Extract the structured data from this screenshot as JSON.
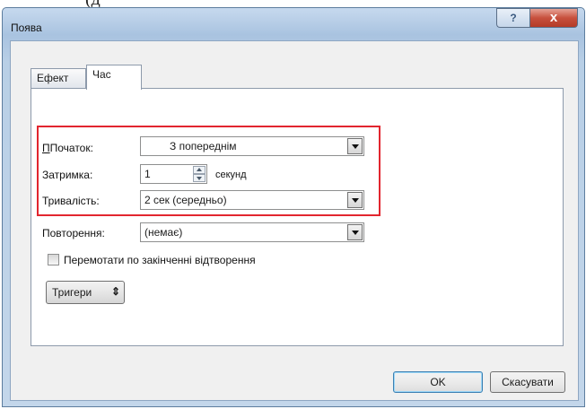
{
  "top_caption": "(д",
  "dialog": {
    "title": "Поява",
    "help_label": "?",
    "close_label": "x"
  },
  "tabs": [
    {
      "label": "Ефект",
      "active": false
    },
    {
      "label": "Час",
      "active": true
    }
  ],
  "fields": {
    "start_label": "Початок:",
    "start_value": "З попереднім",
    "delay_label": "Затримка:",
    "delay_value": "1",
    "delay_unit": "секунд",
    "duration_label": "Тривалість:",
    "duration_value": "2 сек (середньо)",
    "repeat_label": "Повторення:",
    "repeat_value": "(немає)"
  },
  "rewind_checkbox": {
    "label": "Перемотати по закінченні відтворення",
    "checked": false
  },
  "triggers_label": "Тригери",
  "buttons": {
    "ok": "OK",
    "cancel": "Скасувати"
  },
  "colors": {
    "highlight": "#e2262f",
    "close": "#c7503d"
  }
}
